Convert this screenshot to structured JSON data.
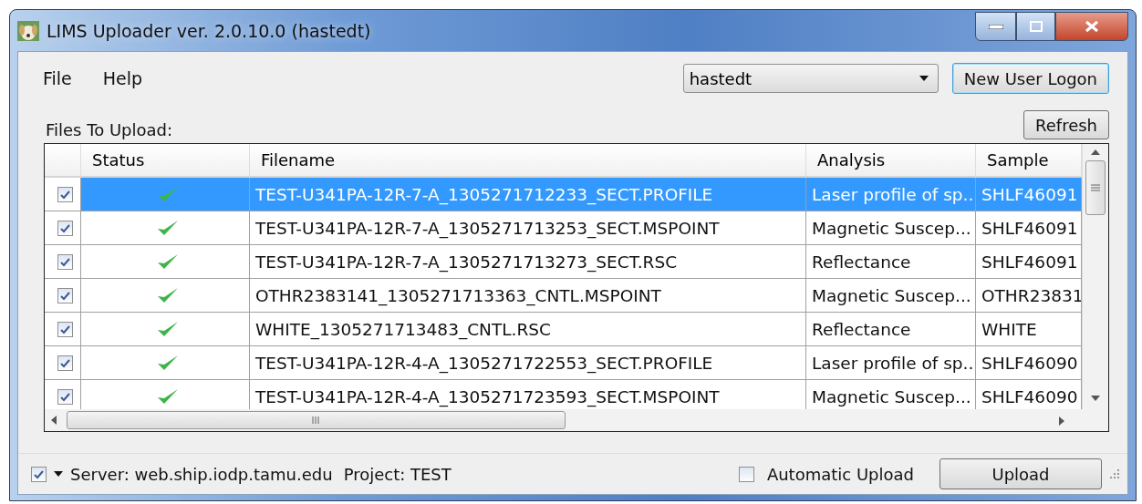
{
  "window": {
    "title": "LIMS Uploader ver. 2.0.10.0  (hastedt)"
  },
  "menu": [
    "File",
    "Help"
  ],
  "user_select": {
    "value": "hastedt"
  },
  "buttons": {
    "logon": "New User Logon",
    "refresh": "Refresh",
    "upload": "Upload"
  },
  "files_label": "Files To Upload:",
  "table": {
    "columns": [
      "Status",
      "Filename",
      "Analysis",
      "Sample"
    ],
    "rows": [
      {
        "checked": true,
        "selected": true,
        "filename": "TEST-U341PA-12R-7-A_1305271712233_SECT.PROFILE",
        "analysis": "Laser profile of sp...",
        "sample": "SHLF46091"
      },
      {
        "checked": true,
        "selected": false,
        "filename": "TEST-U341PA-12R-7-A_1305271713253_SECT.MSPOINT",
        "analysis": "Magnetic Suscep...",
        "sample": "SHLF46091"
      },
      {
        "checked": true,
        "selected": false,
        "filename": "TEST-U341PA-12R-7-A_1305271713273_SECT.RSC",
        "analysis": "Reflectance",
        "sample": "SHLF46091"
      },
      {
        "checked": true,
        "selected": false,
        "filename": "OTHR2383141_1305271713363_CNTL.MSPOINT",
        "analysis": "Magnetic Suscep...",
        "sample": "OTHR23831"
      },
      {
        "checked": true,
        "selected": false,
        "filename": "WHITE_1305271713483_CNTL.RSC",
        "analysis": "Reflectance",
        "sample": "WHITE"
      },
      {
        "checked": true,
        "selected": false,
        "filename": "TEST-U341PA-12R-4-A_1305271722553_SECT.PROFILE",
        "analysis": "Laser profile of sp...",
        "sample": "SHLF46090"
      },
      {
        "checked": true,
        "selected": false,
        "filename": "TEST-U341PA-12R-4-A_1305271723593_SECT.MSPOINT",
        "analysis": "Magnetic Suscep...",
        "sample": "SHLF46090"
      }
    ]
  },
  "status_bar": {
    "checked": true,
    "server": "Server: web.ship.iodp.tamu.edu",
    "project": "Project: TEST",
    "automatic_upload": {
      "label": "Automatic Upload",
      "checked": false
    }
  }
}
